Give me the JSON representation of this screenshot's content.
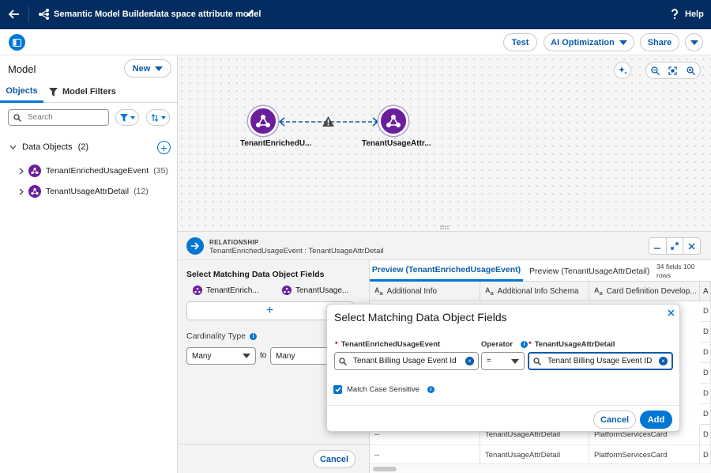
{
  "topbar": {
    "app_title": "Semantic Model Builder",
    "model_title": "data space attribute model",
    "help_label": "Help"
  },
  "toolbar": {
    "test_label": "Test",
    "ai_label": "AI Optimization",
    "share_label": "Share"
  },
  "left_panel": {
    "title": "Model",
    "new_label": "New",
    "tabs": [
      {
        "label": "Objects",
        "active": true
      },
      {
        "label": "Model Filters",
        "active": false
      }
    ],
    "search_placeholder": "Search",
    "group_label": "Data Objects",
    "group_count": "(2)",
    "items": [
      {
        "name": "TenantEnrichedUsageEvent",
        "count": "(35)"
      },
      {
        "name": "TenantUsageAttrDetail",
        "count": "(12)"
      }
    ]
  },
  "canvas": {
    "node_left": "TenantEnrichedU...",
    "node_right": "TenantUsageAttr..."
  },
  "relationship": {
    "kicker": "RELATIONSHIP",
    "subtitle": "TenantEnrichedUsageEvent : TenantUsageAttrDetail",
    "form_title": "Select Matching Data Object Fields",
    "obj_left": "TenantEnrich...",
    "obj_right": "TenantUsage...",
    "add_symbol": "+",
    "cardinality_label": "Cardinality Type",
    "card_from": "Many",
    "to_label": "to",
    "card_to": "Many",
    "cancel_label": "Cancel"
  },
  "preview": {
    "tab1": "Preview (TenantEnrichedUsageEvent)",
    "tab2": "Preview (TenantUsageAttrDetail)",
    "count": "34 fields 100 rows",
    "columns": [
      "Additional Info",
      "Additional Info Schema",
      "Card Definition Develop...",
      "A"
    ],
    "rows": [
      [
        "--",
        "TenantUsageAttrDetail",
        "PlatformServicesCard",
        "D"
      ],
      [
        "--",
        "TenantUsageAttrDetail",
        "PlatformServicesCard",
        "D"
      ]
    ],
    "partial_col_values": [
      "D",
      "D",
      "D",
      "D",
      "D",
      "D",
      "D",
      "D"
    ]
  },
  "popover": {
    "title": "Select Matching Data Object Fields",
    "left_field_label": "TenantEnrichedUsageEvent",
    "left_field_value": "Tenant Billing Usage Event Id",
    "operator_label": "Operator",
    "operator_value": "=",
    "right_field_label": "TenantUsageAttrDetail",
    "right_field_value": "Tenant Billing Usage Event ID",
    "match_case_label": "Match Case Sensitive",
    "match_case_checked": true,
    "cancel_label": "Cancel",
    "add_label": "Add"
  },
  "colors": {
    "brand": "#0176d3",
    "header_bg": "#032d60",
    "object_purple": "#6a1e9c",
    "warning": "#444444"
  }
}
